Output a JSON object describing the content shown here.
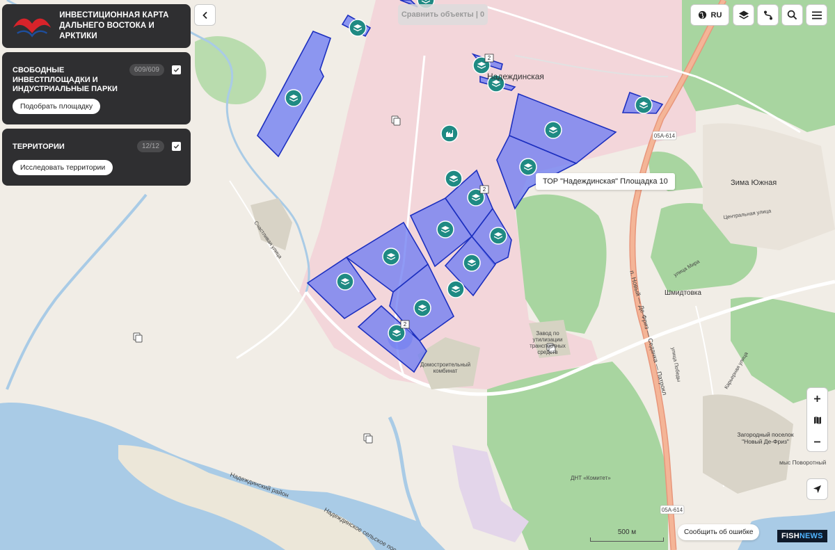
{
  "app": {
    "title_line1": "ИНВЕСТИЦИОННАЯ КАРТА",
    "title_line2": "ДАЛЬНЕГО ВОСТОКА И АРКТИКИ"
  },
  "sections": [
    {
      "title_line1": "СВОБОДНЫЕ",
      "title_line2": "ИНВЕСТПЛОЩАДКИ И",
      "title_line3": "ИНДУСТРИАЛЬНЫЕ ПАРКИ",
      "count": "609/609",
      "button": "Подобрать площадку"
    },
    {
      "title_line1": "ТЕРРИТОРИИ",
      "count": "12/12",
      "button": "Исследовать территории"
    }
  ],
  "toolbar": {
    "compare": "Сравнить объекты | 0",
    "language": "RU"
  },
  "tooltip": "ТОР \"Надеждинская\" Площадка 10",
  "report_error": "Сообщить об ошибке",
  "scale_label": "500 м",
  "watermark_main": "FISH",
  "watermark_accent": "NEWS",
  "map_labels": {
    "settlement_1": "Надеждинская",
    "settlement_2": "Зима Южная",
    "settlement_3": "Шмидтовка",
    "road_1": "05А-614",
    "road_2": "05А-614",
    "highway": "п. Новый — Де-Фриз — Седанка — Патрокл",
    "plant": "Завод по утилизации транспортных средств",
    "kombinat": "Домостроительный комбинат",
    "village": "Загородный поселок \"Новый Де-Фриз\"",
    "district_1": "Надеждинский район",
    "district_2": "Надеждинское сельское поселение",
    "cape": "мыс Поворотный",
    "street_1": "Центральная улица",
    "street_2": "улица Мира",
    "street_3": "улица Победы",
    "street_4": "Карьерная улица",
    "street_5": "Счастливая улица",
    "dnt": "ДНТ «Комитет»",
    "cluster_1": "2",
    "cluster_2": "2",
    "cluster_3": "2"
  },
  "colors": {
    "panel": "#2f2f31",
    "plot_fill": "#6f7df2",
    "plot_stroke": "#1c2fbf",
    "marker": "#1f8a83",
    "territory": "#f3d6da",
    "water": "#a9cbe6",
    "forest": "#a8d5a0"
  },
  "icons": [
    "logo-icon",
    "chevron-left-icon",
    "globe-icon",
    "layers-icon",
    "route-icon",
    "search-icon",
    "menu-icon",
    "plus-icon",
    "map-icon",
    "minus-icon",
    "navigation-icon",
    "checkbox-icon",
    "object-icon"
  ]
}
